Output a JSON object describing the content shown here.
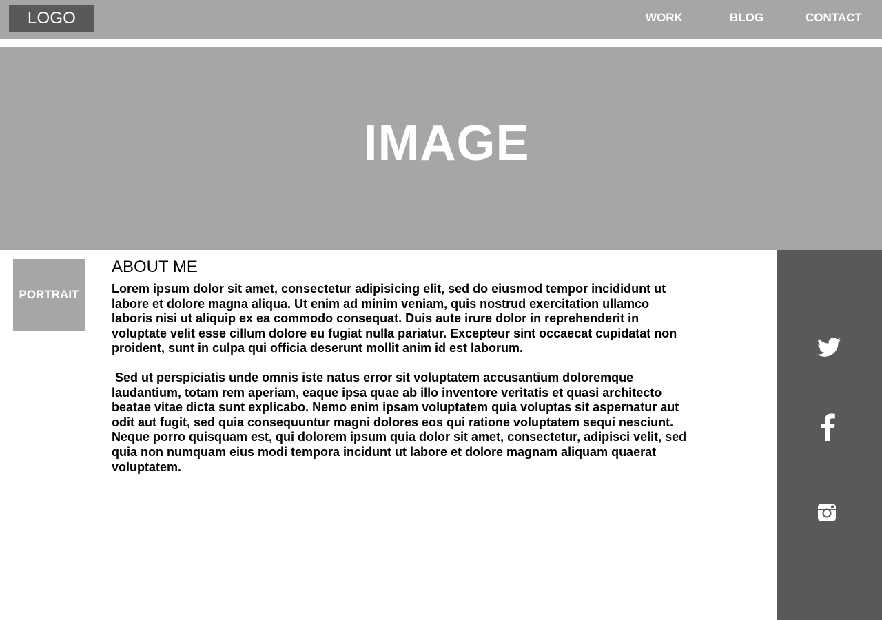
{
  "header": {
    "logo": "LOGO",
    "nav": [
      {
        "label": "WORK"
      },
      {
        "label": "BLOG"
      },
      {
        "label": "CONTACT"
      }
    ]
  },
  "hero": {
    "title": "IMAGE"
  },
  "portrait": {
    "label": "PORTRAIT"
  },
  "about": {
    "heading": "ABOUT ME",
    "paragraphs": [
      "Lorem ipsum dolor sit amet, consectetur adipisicing elit, sed do eiusmod tempor incididunt ut labore et dolore magna aliqua. Ut enim ad minim veniam, quis nostrud exercitation ullamco laboris nisi ut aliquip ex ea commodo consequat. Duis aute irure dolor in reprehenderit in voluptate velit esse cillum dolore eu fugiat nulla pariatur. Excepteur sint occaecat cupidatat non proident, sunt in culpa qui officia deserunt mollit anim id est laborum.",
      " Sed ut perspiciatis unde omnis iste natus error sit voluptatem accusantium doloremque laudantium, totam rem aperiam, eaque ipsa quae ab illo inventore veritatis et quasi architecto beatae vitae dicta sunt explicabo. Nemo enim ipsam voluptatem quia voluptas sit aspernatur aut odit aut fugit, sed quia consequuntur magni dolores eos qui ratione voluptatem sequi nesciunt. Neque porro quisquam est, qui dolorem ipsum quia dolor sit amet, consectetur, adipisci velit, sed quia non numquam eius modi tempora incidunt ut labore et dolore magnam aliquam quaerat voluptatem."
    ]
  },
  "social": {
    "icons": [
      "twitter-icon",
      "facebook-icon",
      "instagram-icon"
    ]
  },
  "colors": {
    "header_bg": "#a6a6a6",
    "logo_bg": "#595959",
    "hero_bg": "#a6a6a6",
    "sidebar_bg": "#595959",
    "text": "#000000",
    "inverse_text": "#ffffff"
  }
}
